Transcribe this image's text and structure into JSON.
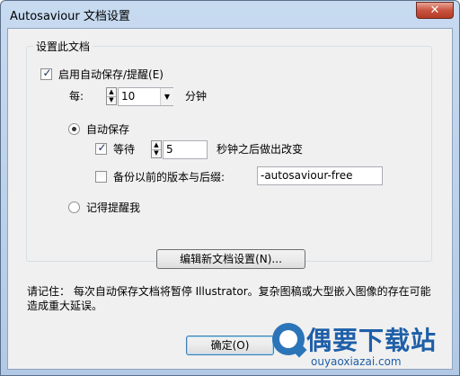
{
  "window": {
    "title": "Autosaviour 文档设置",
    "close_glyph": "✕"
  },
  "group": {
    "legend": "设置此文档",
    "enable_autosave": {
      "label": "启用自动保存/提醒(E)",
      "checked": true
    },
    "interval": {
      "prefix": "每:",
      "value": "10",
      "unit": "分钟"
    },
    "autosave_radio": {
      "label": "自动保存",
      "selected": true
    },
    "wait": {
      "label": "等待",
      "checked": true,
      "value": "5",
      "unit": "秒钟之后做出改变"
    },
    "backup": {
      "label": "备份以前的版本与后缀:",
      "checked": false,
      "suffix": "-autosaviour-free"
    },
    "remind_radio": {
      "label": "记得提醒我",
      "selected": false
    }
  },
  "edit_defaults_button": "编辑新文档设置(N)...",
  "note_text": "请记住： 每次自动保存文档将暂停 Illustrator。复杂图稿或大型嵌入图像的存在可能造成重大延误。",
  "ok_button": "确定(O)",
  "icons": {
    "check": "✓",
    "spin_up": "▲",
    "spin_down": "▼",
    "dropdown": "▼"
  },
  "watermark": {
    "text": "偶要下载站",
    "url": "ouyaoxiazai.com"
  }
}
